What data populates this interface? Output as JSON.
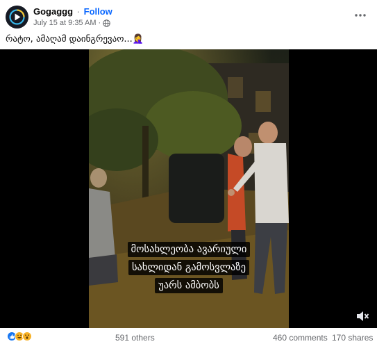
{
  "post": {
    "author": "Gogaggg",
    "separator": "·",
    "follow_label": "Follow",
    "timestamp": "July 15 at 9:35 AM",
    "separator_meta": "·",
    "audience_icon": "globe-icon",
    "more_icon": "more-horizontal-icon",
    "caption_text": "რატო, ამაღამ დაინგრევაო...",
    "caption_emoji": "🤦‍♀️"
  },
  "video": {
    "subtitle_lines": [
      "მოსახლეობა ავარიული",
      "სახლიდან გამოსვლაზე",
      "უარს ამბობს"
    ],
    "mute_icon": "volume-muted-icon"
  },
  "footer": {
    "reaction_icons": [
      "like-icon",
      "haha-icon",
      "wow-icon"
    ],
    "reactions_count": "591 others",
    "comments_count": "460 comments",
    "shares_count": "170 shares"
  },
  "colors": {
    "accent": "#0866ff",
    "secondary_text": "#65676b",
    "video_background": "#000000",
    "like_blue": "#1877f2",
    "haha_yellow": "#f7b125",
    "wow_red": "#e9710f"
  }
}
